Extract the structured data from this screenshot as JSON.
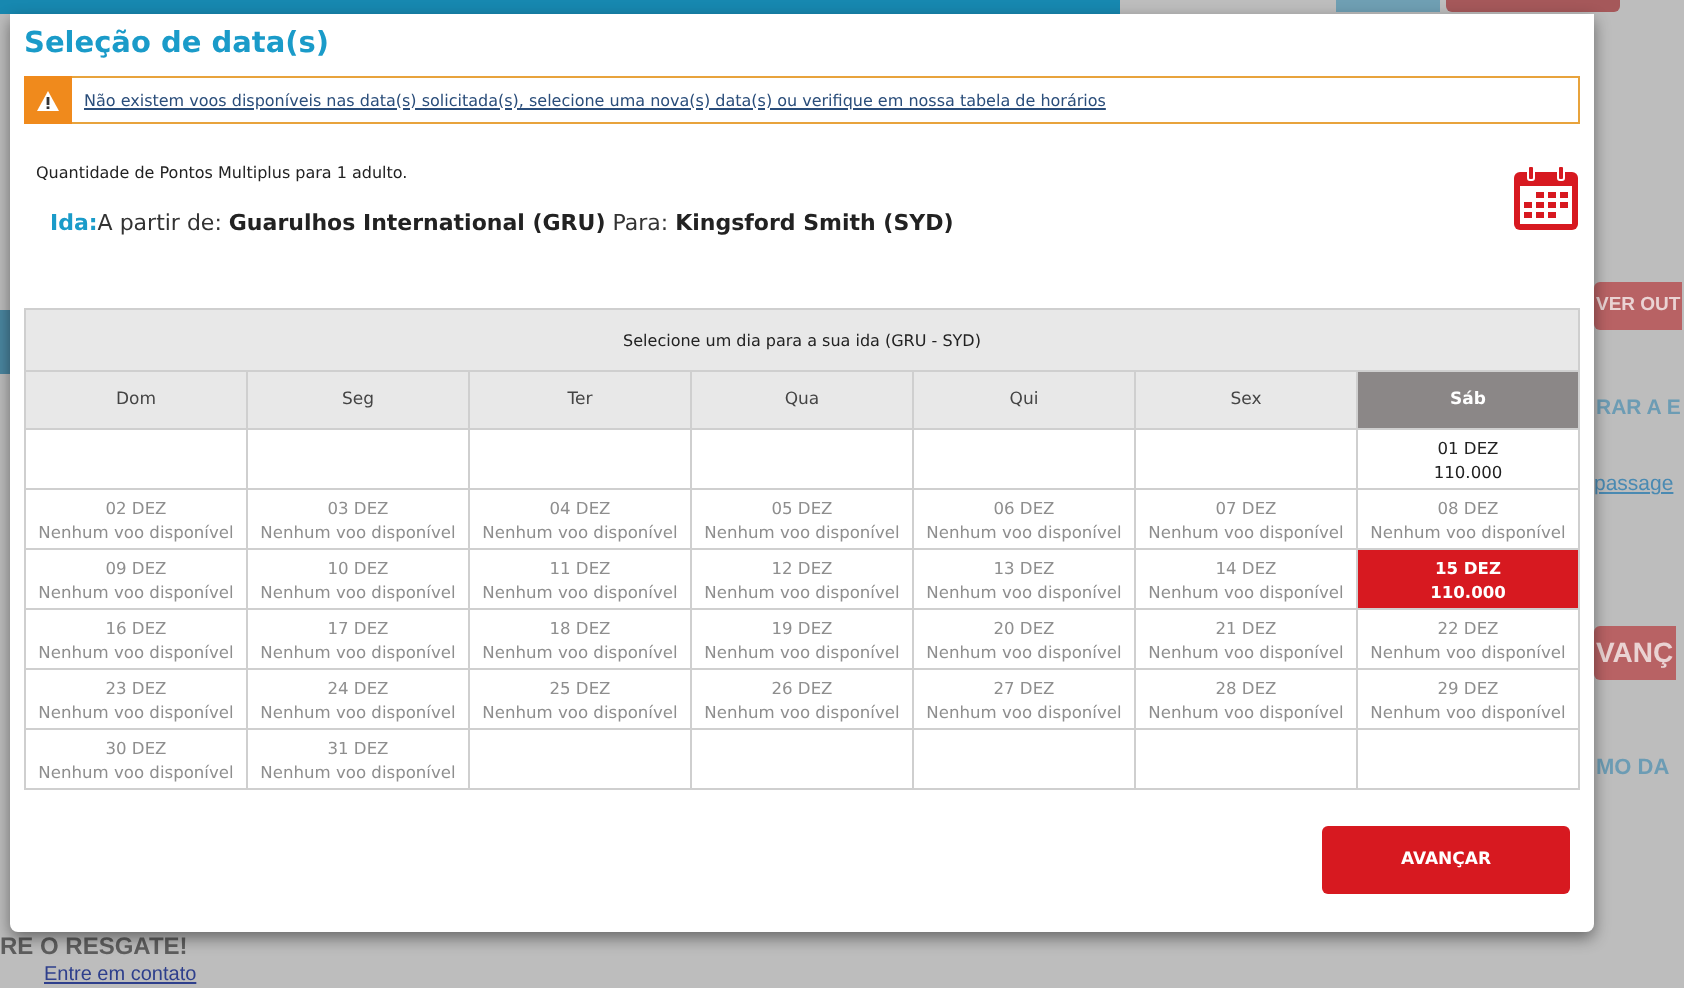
{
  "background_page": [
    {
      "kind": "red-button",
      "text": "VER OUT"
    },
    {
      "kind": "heading",
      "text": "RAR A E"
    },
    {
      "kind": "link",
      "text": "passage"
    },
    {
      "kind": "red-button",
      "text": "VANÇ"
    },
    {
      "kind": "heading",
      "text": "MO DA"
    },
    {
      "kind": "heading",
      "text": "RE O RESGATE!"
    },
    {
      "kind": "link",
      "text": "Entre em contato"
    }
  ],
  "dialog": {
    "title": "Seleção de data(s)",
    "alert": {
      "text": "Não existem voos disponíveis nas data(s) solicitada(s), selecione uma nova(s) data(s) ou verifique em nossa tabela de horários"
    },
    "points_note": "Quantidade de Pontos Multiplus para 1 adulto.",
    "route": {
      "label": "Ida:",
      "from_label": "A partir de:",
      "from": "Guarulhos International (GRU)",
      "to_label": "Para:",
      "to": "Kingsford Smith (SYD)"
    },
    "calendar": {
      "caption": "Selecione um dia para a sua ida (GRU - SYD)",
      "days": [
        {
          "label": "Dom",
          "selected": false
        },
        {
          "label": "Seg",
          "selected": false
        },
        {
          "label": "Ter",
          "selected": false
        },
        {
          "label": "Qua",
          "selected": false
        },
        {
          "label": "Qui",
          "selected": false
        },
        {
          "label": "Sex",
          "selected": false
        },
        {
          "label": "Sáb",
          "selected": true
        }
      ],
      "weeks": [
        [
          {
            "kind": "empty"
          },
          {
            "kind": "empty"
          },
          {
            "kind": "empty"
          },
          {
            "kind": "empty"
          },
          {
            "kind": "empty"
          },
          {
            "kind": "empty"
          },
          {
            "kind": "available",
            "date": "01 DEZ",
            "info": "110.000",
            "selected": false
          }
        ],
        [
          {
            "kind": "unavailable",
            "date": "02 DEZ",
            "info": "Nenhum voo disponível"
          },
          {
            "kind": "unavailable",
            "date": "03 DEZ",
            "info": "Nenhum voo disponível"
          },
          {
            "kind": "unavailable",
            "date": "04 DEZ",
            "info": "Nenhum voo disponível"
          },
          {
            "kind": "unavailable",
            "date": "05 DEZ",
            "info": "Nenhum voo disponível"
          },
          {
            "kind": "unavailable",
            "date": "06 DEZ",
            "info": "Nenhum voo disponível"
          },
          {
            "kind": "unavailable",
            "date": "07 DEZ",
            "info": "Nenhum voo disponível"
          },
          {
            "kind": "unavailable",
            "date": "08 DEZ",
            "info": "Nenhum voo disponível"
          }
        ],
        [
          {
            "kind": "unavailable",
            "date": "09 DEZ",
            "info": "Nenhum voo disponível"
          },
          {
            "kind": "unavailable",
            "date": "10 DEZ",
            "info": "Nenhum voo disponível"
          },
          {
            "kind": "unavailable",
            "date": "11 DEZ",
            "info": "Nenhum voo disponível"
          },
          {
            "kind": "unavailable",
            "date": "12 DEZ",
            "info": "Nenhum voo disponível"
          },
          {
            "kind": "unavailable",
            "date": "13 DEZ",
            "info": "Nenhum voo disponível"
          },
          {
            "kind": "unavailable",
            "date": "14 DEZ",
            "info": "Nenhum voo disponível"
          },
          {
            "kind": "available",
            "date": "15 DEZ",
            "info": "110.000",
            "selected": true
          }
        ],
        [
          {
            "kind": "unavailable",
            "date": "16 DEZ",
            "info": "Nenhum voo disponível"
          },
          {
            "kind": "unavailable",
            "date": "17 DEZ",
            "info": "Nenhum voo disponível"
          },
          {
            "kind": "unavailable",
            "date": "18 DEZ",
            "info": "Nenhum voo disponível"
          },
          {
            "kind": "unavailable",
            "date": "19 DEZ",
            "info": "Nenhum voo disponível"
          },
          {
            "kind": "unavailable",
            "date": "20 DEZ",
            "info": "Nenhum voo disponível"
          },
          {
            "kind": "unavailable",
            "date": "21 DEZ",
            "info": "Nenhum voo disponível"
          },
          {
            "kind": "unavailable",
            "date": "22 DEZ",
            "info": "Nenhum voo disponível"
          }
        ],
        [
          {
            "kind": "unavailable",
            "date": "23 DEZ",
            "info": "Nenhum voo disponível"
          },
          {
            "kind": "unavailable",
            "date": "24 DEZ",
            "info": "Nenhum voo disponível"
          },
          {
            "kind": "unavailable",
            "date": "25 DEZ",
            "info": "Nenhum voo disponível"
          },
          {
            "kind": "unavailable",
            "date": "26 DEZ",
            "info": "Nenhum voo disponível"
          },
          {
            "kind": "unavailable",
            "date": "27 DEZ",
            "info": "Nenhum voo disponível"
          },
          {
            "kind": "unavailable",
            "date": "28 DEZ",
            "info": "Nenhum voo disponível"
          },
          {
            "kind": "unavailable",
            "date": "29 DEZ",
            "info": "Nenhum voo disponível"
          }
        ],
        [
          {
            "kind": "unavailable",
            "date": "30 DEZ",
            "info": "Nenhum voo disponível"
          },
          {
            "kind": "unavailable",
            "date": "31 DEZ",
            "info": "Nenhum voo disponível"
          },
          {
            "kind": "empty"
          },
          {
            "kind": "empty"
          },
          {
            "kind": "empty"
          },
          {
            "kind": "empty"
          },
          {
            "kind": "empty"
          }
        ]
      ]
    },
    "button": "AVANÇAR"
  }
}
